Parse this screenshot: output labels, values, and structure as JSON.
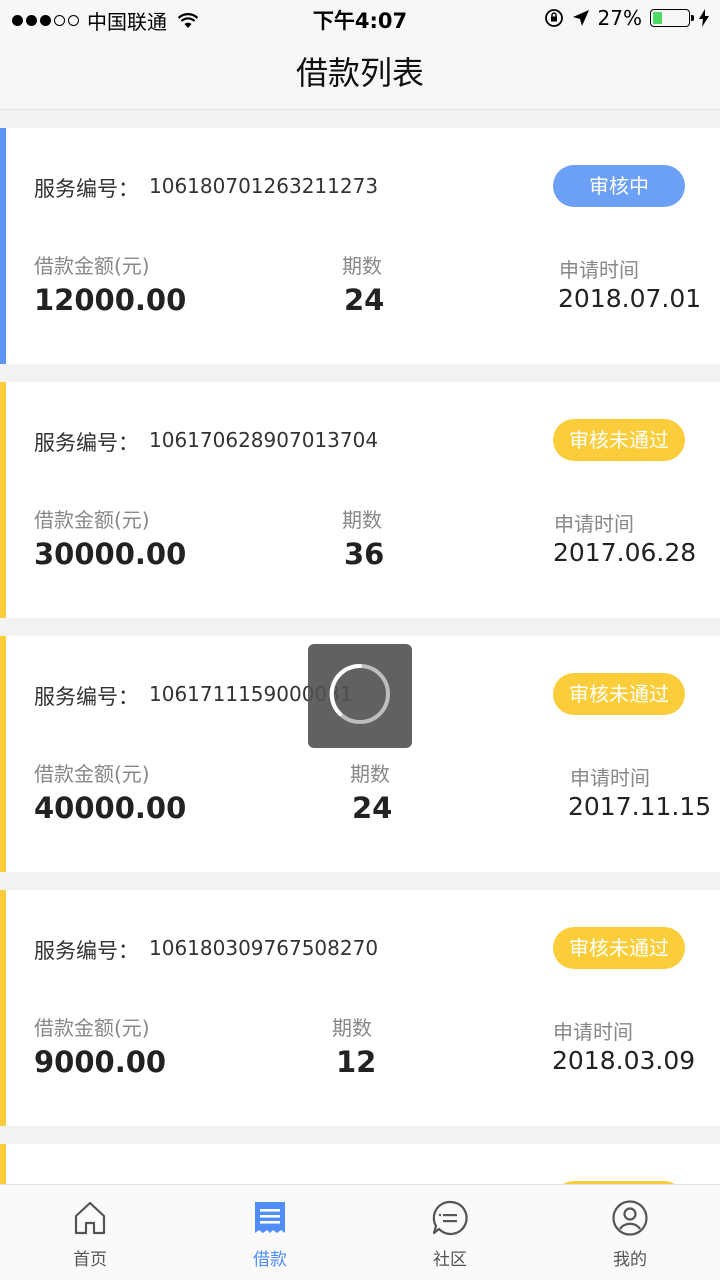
{
  "status": {
    "carrier": "中国联通",
    "time": "下午4:07",
    "battery": "27%",
    "battery_level": 0.27
  },
  "nav": {
    "title": "借款列表"
  },
  "labels": {
    "service_no": "服务编号：",
    "amount": "借款金额(元)",
    "periods": "期数",
    "apply_time": "申请时间"
  },
  "colors": {
    "blue": "#5b96f5",
    "yellow": "#fbcd3a",
    "accent": "#4e8ef6"
  },
  "loans": [
    {
      "service_no": "106180701263211273",
      "status": "审核中",
      "amount": "12000.00",
      "periods": "24",
      "apply_time": "2018.07.01",
      "color": "#5b96f5"
    },
    {
      "service_no": "106170628907013704",
      "status": "审核未通过",
      "amount": "30000.00",
      "periods": "36",
      "apply_time": "2017.06.28",
      "color": "#fbcd3a"
    },
    {
      "service_no": "1061711159000031",
      "status": "审核未通过",
      "amount": "40000.00",
      "periods": "24",
      "apply_time": "2017.11.15",
      "color": "#fbcd3a"
    },
    {
      "service_no": "106180309767508270",
      "status": "审核未通过",
      "amount": "9000.00",
      "periods": "12",
      "apply_time": "2018.03.09",
      "color": "#fbcd3a"
    }
  ],
  "tabs": [
    {
      "label": "首页",
      "icon": "home-icon"
    },
    {
      "label": "借款",
      "icon": "loan-document-icon",
      "active": true
    },
    {
      "label": "社区",
      "icon": "community-chat-icon"
    },
    {
      "label": "我的",
      "icon": "profile-icon"
    }
  ]
}
